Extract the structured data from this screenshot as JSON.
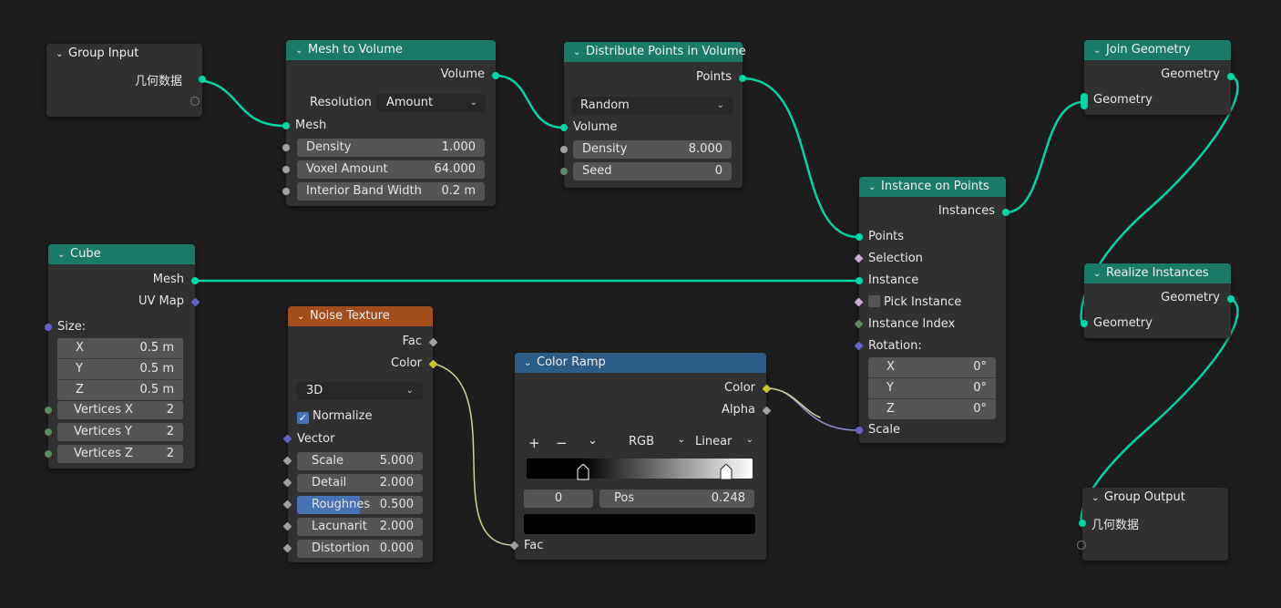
{
  "nodes": {
    "group_input": {
      "title": "Group Input",
      "out_geometry": "几何数据"
    },
    "mesh_to_volume": {
      "title": "Mesh to Volume",
      "out_volume": "Volume",
      "resolution_label": "Resolution",
      "resolution_value": "Amount",
      "in_mesh": "Mesh",
      "density_label": "Density",
      "density_value": "1.000",
      "voxel_label": "Voxel Amount",
      "voxel_value": "64.000",
      "band_label": "Interior Band Width",
      "band_value": "0.2 m"
    },
    "distribute": {
      "title": "Distribute Points in Volume",
      "out_points": "Points",
      "mode": "Random",
      "in_volume": "Volume",
      "density_label": "Density",
      "density_value": "8.000",
      "seed_label": "Seed",
      "seed_value": "0"
    },
    "join": {
      "title": "Join Geometry",
      "out_geometry": "Geometry",
      "in_geometry": "Geometry"
    },
    "instance_on_points": {
      "title": "Instance on Points",
      "out_instances": "Instances",
      "in_points": "Points",
      "in_selection": "Selection",
      "in_instance": "Instance",
      "pick_instance": "Pick Instance",
      "in_instance_index": "Instance Index",
      "in_rotation": "Rotation:",
      "rot_x_label": "X",
      "rot_x": "0°",
      "rot_y_label": "Y",
      "rot_y": "0°",
      "rot_z_label": "Z",
      "rot_z": "0°",
      "in_scale": "Scale"
    },
    "realize": {
      "title": "Realize Instances",
      "out_geometry": "Geometry",
      "in_geometry": "Geometry"
    },
    "cube": {
      "title": "Cube",
      "out_mesh": "Mesh",
      "out_uvmap": "UV Map",
      "size_label": "Size:",
      "x_label": "X",
      "x_value": "0.5 m",
      "y_label": "Y",
      "y_value": "0.5 m",
      "z_label": "Z",
      "z_value": "0.5 m",
      "vx_label": "Vertices X",
      "vx_value": "2",
      "vy_label": "Vertices Y",
      "vy_value": "2",
      "vz_label": "Vertices Z",
      "vz_value": "2"
    },
    "noise": {
      "title": "Noise Texture",
      "out_fac": "Fac",
      "out_color": "Color",
      "dimensions": "3D",
      "normalize_label": "Normalize",
      "normalize_checked": true,
      "in_vector": "Vector",
      "scale_label": "Scale",
      "scale_value": "5.000",
      "detail_label": "Detail",
      "detail_value": "2.000",
      "rough_label": "Roughnes",
      "rough_value": "0.500",
      "lacun_label": "Lacunarit",
      "lacun_value": "2.000",
      "distort_label": "Distortion",
      "distort_value": "0.000"
    },
    "color_ramp": {
      "title": "Color Ramp",
      "out_color": "Color",
      "out_alpha": "Alpha",
      "add": "+",
      "remove": "−",
      "menu": "⌄",
      "color_mode": "RGB",
      "interpolation": "Linear",
      "stop_index": "0",
      "pos_label": "Pos",
      "pos_value": "0.248",
      "in_fac": "Fac"
    },
    "group_output": {
      "title": "Group Output",
      "in_geometry": "几何数据"
    }
  },
  "colors": {
    "geometry_socket": "#00d6a3",
    "geometry_header": "#1a7a68",
    "texture_header": "#a14e1c",
    "converter_header": "#2b5c85",
    "vector_socket": "#6363c7",
    "color_socket": "#c7c729",
    "float_socket": "#a1a1a1",
    "int_socket": "#598c5c"
  }
}
